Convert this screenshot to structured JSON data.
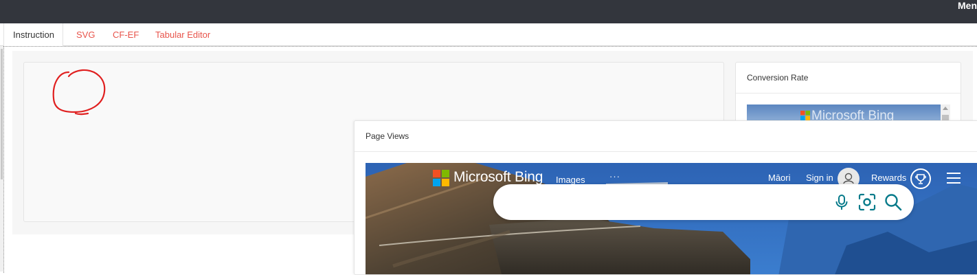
{
  "topbar": {
    "menu_label": "Men"
  },
  "tabs": [
    {
      "label": "Instruction",
      "active": true
    },
    {
      "label": "SVG",
      "active": false
    },
    {
      "label": "CF-EF",
      "active": false
    },
    {
      "label": "Tabular Editor",
      "active": false
    }
  ],
  "cards": {
    "conversion_rate": {
      "title": "Conversion Rate",
      "thumbnail_text": "Microsoft Bing"
    },
    "page_views": {
      "title": "Page Views"
    }
  },
  "bing": {
    "brand": "Microsoft Bing",
    "nav": {
      "images": "Images",
      "more": "···"
    },
    "language": "Māori",
    "sign_in": "Sign in",
    "rewards": "Rewards",
    "search": {
      "value": "",
      "placeholder": ""
    }
  },
  "colors": {
    "topbar": "#33363d",
    "tab_link": "#e8534a",
    "scribble": "#e02020",
    "bing_accent": "#067a8a",
    "ms_red": "#f25022",
    "ms_green": "#7fba00",
    "ms_blue": "#00a4ef",
    "ms_yellow": "#ffb900"
  },
  "icons": [
    "microsoft-logo-icon",
    "user-avatar-icon",
    "trophy-icon",
    "hamburger-menu-icon",
    "microphone-icon",
    "visual-search-icon",
    "search-icon"
  ]
}
